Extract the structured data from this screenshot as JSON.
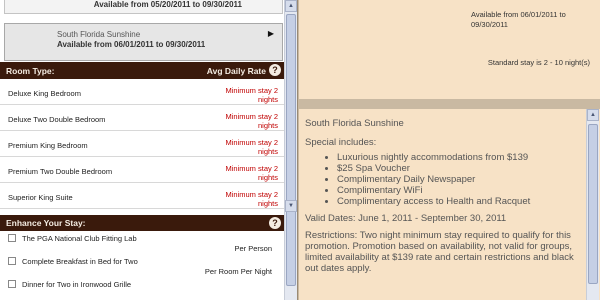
{
  "packages": [
    {
      "availability": "Available from 05/20/2011 to 09/30/2011"
    },
    {
      "name": "South Florida Sunshine",
      "availability": "Available from 06/01/2011 to 09/30/2011",
      "arrow": "▶"
    }
  ],
  "rooms_header": {
    "title": "Room Type:",
    "rate_label": "Avg Daily Rate",
    "help": "?"
  },
  "rooms": [
    {
      "name": "Deluxe King Bedroom",
      "stay_line1": "Minimum stay 2",
      "stay_line2": "nights"
    },
    {
      "name": "Deluxe Two Double Bedroom",
      "stay_line1": "Minimum stay 2",
      "stay_line2": "nights"
    },
    {
      "name": "Premium King Bedroom",
      "stay_line1": "Minimum stay 2",
      "stay_line2": "nights"
    },
    {
      "name": "Premium Two Double Bedroom",
      "stay_line1": "Minimum stay 2",
      "stay_line2": "nights"
    },
    {
      "name": "Superior King Suite",
      "stay_line1": "Minimum stay 2",
      "stay_line2": "nights"
    }
  ],
  "enhance_header": {
    "title": "Enhance Your Stay:",
    "help": "?"
  },
  "extras": [
    {
      "name": "The PGA National Club Fitting Lab",
      "price_unit": "Per Person"
    },
    {
      "name": "Complete Breakfast in Bed for Two",
      "price_unit": "Per Room Per Night"
    },
    {
      "name": "Dinner for Two in Ironwood Grille",
      "price_unit": ""
    }
  ],
  "right": {
    "availability": "Available from 06/01/2011 to 09/30/2011",
    "standard_stay": "Standard stay is 2 - 10 night(s)",
    "package_title": "South Florida Sunshine",
    "special_includes": "Special includes:",
    "includes": [
      "Luxurious nightly accommodations from $139",
      "$25 Spa Voucher",
      "Complimentary Daily Newspaper",
      "Complimentary WiFi",
      "Complimentary access to Health and Racquet"
    ],
    "valid_dates": "Valid Dates: June 1, 2011 - September 30, 2011",
    "restrictions": "Restrictions: Two night minimum stay required to qualify for this promotion. Promotion based on availability, not valid for groups, limited availability at $139 rate and certain restrictions and black out dates apply."
  },
  "icons": {
    "scroll_up": "▲",
    "scroll_down": "▼",
    "help": "help-icon",
    "arrow": "arrow-right-icon"
  },
  "colors": {
    "header_bg": "#3a1a0c",
    "min_stay_red": "#c00000",
    "card_bg": "#f7e2c6",
    "frame_bg": "#c9b9a2"
  }
}
